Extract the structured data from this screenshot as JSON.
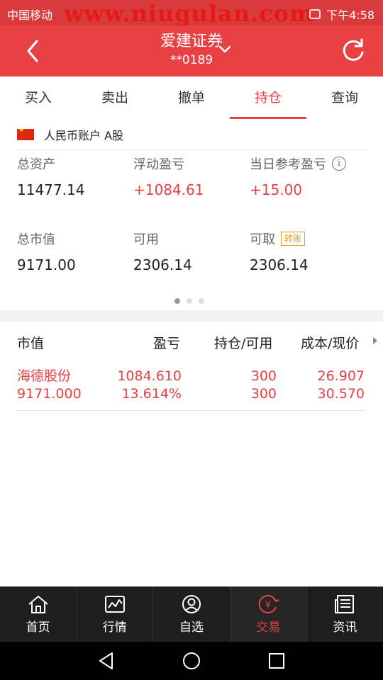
{
  "status_bar": {
    "carrier": "中国移动",
    "time": "下午4:58",
    "watermark": "www.niugulan.com"
  },
  "header": {
    "title": "爱建证券",
    "account": "**0189",
    "back_icon": "back-arrow-icon",
    "refresh_icon": "refresh-icon"
  },
  "tabs": [
    {
      "label": "买入"
    },
    {
      "label": "卖出"
    },
    {
      "label": "撤单"
    },
    {
      "label": "持仓",
      "active": true
    },
    {
      "label": "查询"
    }
  ],
  "account_row": {
    "label": "人民币账户 A股",
    "flag_icon": "china-flag-icon"
  },
  "summary": {
    "total_assets_label": "总资产",
    "total_assets": "11477.14",
    "floating_pl_label": "浮动盈亏",
    "floating_pl": "+1084.61",
    "today_pl_label": "当日参考盈亏",
    "today_pl": "+15.00",
    "market_value_label": "总市值",
    "market_value": "9171.00",
    "available_label": "可用",
    "available": "2306.14",
    "withdrawable_label": "可取",
    "withdrawable": "2306.14",
    "transfer_badge": "转账",
    "page_dots": 3,
    "active_dot": 1
  },
  "holdings": {
    "headers": [
      "市值",
      "盈亏",
      "持仓/可用",
      "成本/现价"
    ],
    "rows": [
      {
        "name": "海德股份",
        "market_value": "9171.000",
        "pl": "1084.610",
        "pl_pct": "13.614%",
        "position": "300",
        "available": "300",
        "cost": "26.907",
        "price": "30.570"
      }
    ]
  },
  "bottom_nav": [
    {
      "label": "首页",
      "icon": "home-icon"
    },
    {
      "label": "行情",
      "icon": "chart-icon"
    },
    {
      "label": "自选",
      "icon": "user-icon"
    },
    {
      "label": "交易",
      "icon": "yuan-trade-icon",
      "active": true
    },
    {
      "label": "资讯",
      "icon": "news-icon"
    }
  ],
  "colors": {
    "brand_red": "#e94043",
    "status_red": "#d93a3b",
    "badge_gold": "#e0a21b",
    "nav_dark": "#1e1e1e"
  }
}
